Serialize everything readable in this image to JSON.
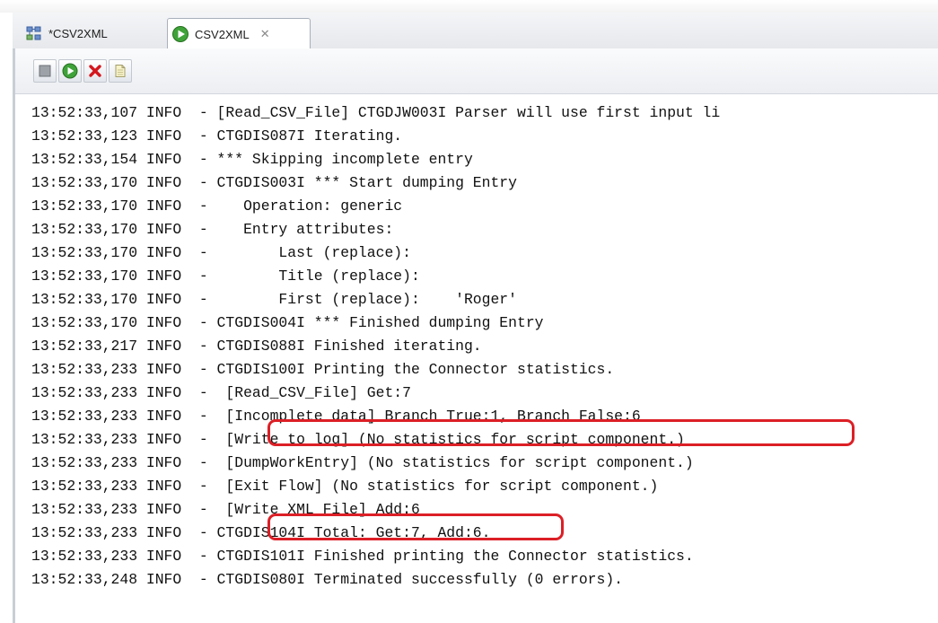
{
  "tabs": [
    {
      "label": "*CSV2XML",
      "icon": "connector-icon",
      "active": false
    },
    {
      "label": "CSV2XML",
      "icon": "run-icon",
      "active": true
    }
  ],
  "toolbar": [
    "stop-icon",
    "run-icon",
    "close-icon",
    "page-icon"
  ],
  "log_lines": [
    "13:52:33,107 INFO  - [Read_CSV_File] CTGDJW003I Parser will use first input li",
    "13:52:33,123 INFO  - CTGDIS087I Iterating.",
    "13:52:33,154 INFO  - *** Skipping incomplete entry",
    "13:52:33,170 INFO  - CTGDIS003I *** Start dumping Entry",
    "13:52:33,170 INFO  -    Operation: generic",
    "13:52:33,170 INFO  -    Entry attributes:",
    "13:52:33,170 INFO  -        Last (replace):",
    "13:52:33,170 INFO  -        Title (replace):",
    "13:52:33,170 INFO  -        First (replace):    'Roger'",
    "13:52:33,170 INFO  - CTGDIS004I *** Finished dumping Entry",
    "13:52:33,217 INFO  - CTGDIS088I Finished iterating.",
    "13:52:33,233 INFO  - CTGDIS100I Printing the Connector statistics.",
    "13:52:33,233 INFO  -  [Read_CSV_File] Get:7",
    "13:52:33,233 INFO  -  [Incomplete data] Branch True:1, Branch False:6",
    "13:52:33,233 INFO  -  [Write to log] (No statistics for script component.)",
    "13:52:33,233 INFO  -  [DumpWorkEntry] (No statistics for script component.)",
    "13:52:33,233 INFO  -  [Exit Flow] (No statistics for script component.)",
    "13:52:33,233 INFO  -  [Write_XML_File] Add:6",
    "13:52:33,233 INFO  - CTGDIS104I Total: Get:7, Add:6.",
    "13:52:33,233 INFO  - CTGDIS101I Finished printing the Connector statistics.",
    "13:52:33,248 INFO  - CTGDIS080I Terminated successfully (0 errors)."
  ],
  "highlight_color": "#dc1f26"
}
